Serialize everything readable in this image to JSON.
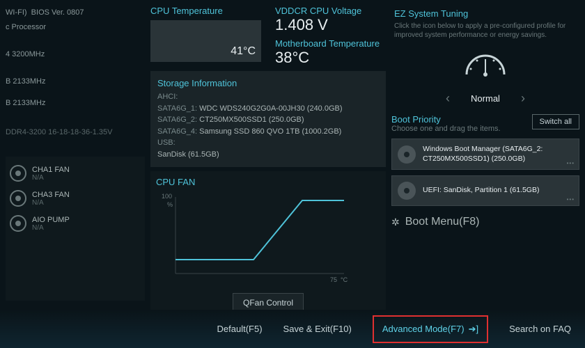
{
  "sysinfo": {
    "line1_left": "WI-FI)",
    "bios": "BIOS Ver. 0807",
    "cpu_suffix": "c Processor",
    "mem_freq": "4 3200MHz",
    "memA": "B 2133MHz",
    "memB": "B 2133MHz",
    "timing": "DDR4-3200 16-18-18-36-1.35V"
  },
  "cpu_temp": {
    "label": "CPU Temperature",
    "value": "41°C"
  },
  "vddcr": {
    "label": "VDDCR CPU Voltage",
    "value": "1.408 V"
  },
  "mb_temp": {
    "label": "Motherboard Temperature",
    "value": "38°C"
  },
  "storage": {
    "title": "Storage Information",
    "ahci_label": "AHCI:",
    "items": [
      {
        "port": "SATA6G_1:",
        "name": "WDC WDS240G2G0A-00JH30 (240.0GB)"
      },
      {
        "port": "SATA6G_2:",
        "name": "CT250MX500SSD1 (250.0GB)"
      },
      {
        "port": "SATA6G_4:",
        "name": "Samsung SSD 860 QVO 1TB (1000.2GB)"
      }
    ],
    "usb_label": "USB:",
    "usb_item": "SanDisk (61.5GB)"
  },
  "fans": {
    "list": [
      {
        "name": "CHA1 FAN",
        "status": "N/A"
      },
      {
        "name": "CHA3 FAN",
        "status": "N/A"
      },
      {
        "name": "AIO PUMP",
        "status": "N/A"
      }
    ],
    "chart_title": "CPU FAN",
    "unit": "%",
    "y_max": "100",
    "x_max": "75",
    "x_unit": "°C",
    "qfan_btn": "QFan Control"
  },
  "tuning": {
    "title": "EZ System Tuning",
    "desc": "Click the icon below to apply a pre-configured profile for improved system performance or energy savings.",
    "profile": "Normal"
  },
  "boot": {
    "title": "Boot Priority",
    "desc": "Choose one and drag the items.",
    "switch": "Switch all",
    "items": [
      "Windows Boot Manager (SATA6G_2: CT250MX500SSD1) (250.0GB)",
      "UEFI: SanDisk, Partition 1 (61.5GB)"
    ],
    "menu": "Boot Menu(F8)"
  },
  "footer": {
    "default": "Default(F5)",
    "save": "Save & Exit(F10)",
    "advanced": "Advanced Mode(F7)",
    "search": "Search on FAQ"
  },
  "chart_data": {
    "type": "line",
    "title": "CPU FAN",
    "xlabel": "°C",
    "ylabel": "%",
    "xlim": [
      0,
      75
    ],
    "ylim": [
      0,
      100
    ],
    "series": [
      {
        "name": "Fan Curve",
        "x": [
          0,
          40,
          60,
          75
        ],
        "y": [
          20,
          20,
          100,
          100
        ]
      }
    ]
  }
}
